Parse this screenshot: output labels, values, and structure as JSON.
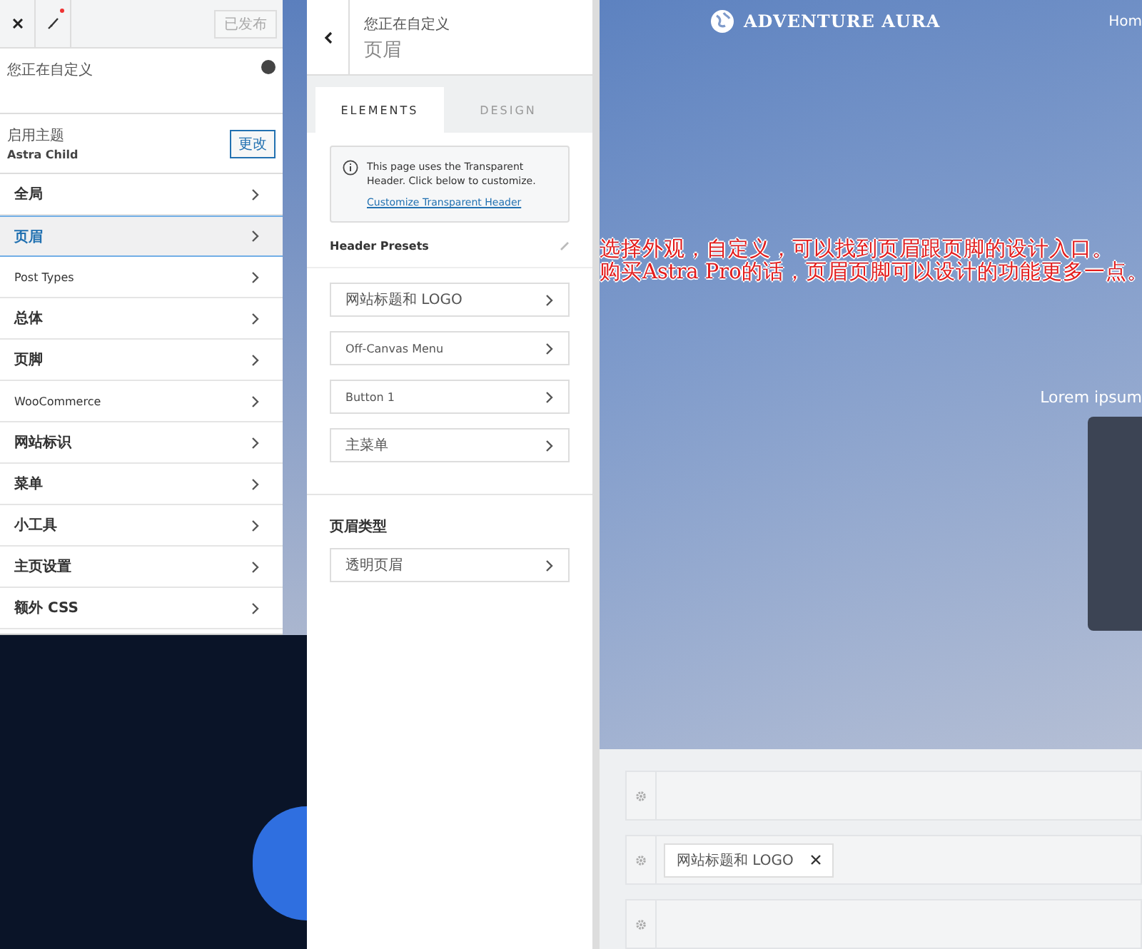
{
  "customizer": {
    "publish_button": "已发布",
    "customizing_label": "您正在自定义",
    "theme": {
      "label": "启用主题",
      "name": "Astra Child",
      "change_button": "更改"
    },
    "menu": [
      {
        "label": "全局",
        "selected": false
      },
      {
        "label": "页眉",
        "selected": true
      },
      {
        "label": "Post Types",
        "selected": false
      },
      {
        "label": "总体",
        "selected": false
      },
      {
        "label": "页脚",
        "selected": false
      },
      {
        "label": "WooCommerce",
        "selected": false
      },
      {
        "label": "网站标识",
        "selected": false
      },
      {
        "label": "菜单",
        "selected": false
      },
      {
        "label": "小工具",
        "selected": false
      },
      {
        "label": "主页设置",
        "selected": false
      },
      {
        "label": "额外 CSS",
        "selected": false
      }
    ]
  },
  "section_panel": {
    "customizing_label": "您正在自定义",
    "title": "页眉",
    "tabs": [
      {
        "label": "ELEMENTS",
        "selected": true
      },
      {
        "label": "DESIGN",
        "selected": false
      }
    ],
    "notice": {
      "text": "This page uses the Transparent Header. Click below to customize.",
      "link": "Customize Transparent Header"
    },
    "presets_heading": "Header Presets",
    "elements": [
      "网站标题和 LOGO",
      "Off-Canvas Menu",
      "Button 1",
      "主菜单"
    ],
    "type_heading": "页眉类型",
    "type_items": [
      "透明页眉"
    ]
  },
  "preview": {
    "logo": "ADVENTURE AURA",
    "nav_item": "Hom",
    "annotation": [
      "选择外观，自定义，可以找到页眉跟页脚的设计入口。",
      "购买Astra Pro的话，页眉页脚可以设计的功能更多一点。"
    ],
    "hero_text": "Lorem ipsum",
    "builder_rows": [
      {
        "kind": "empty"
      },
      {
        "kind": "element",
        "label": "网站标题和 LOGO"
      },
      {
        "kind": "empty"
      }
    ]
  }
}
